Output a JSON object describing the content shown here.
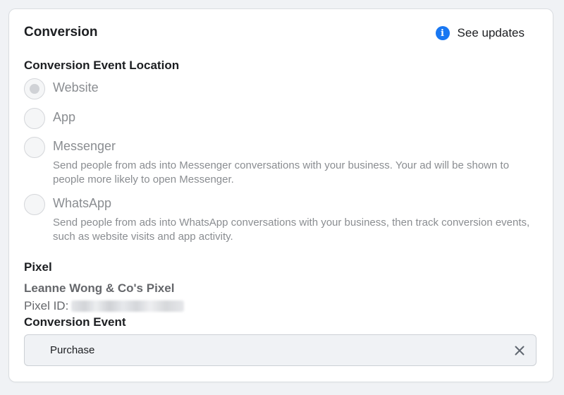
{
  "header": {
    "title": "Conversion",
    "updates_icon": "info-icon",
    "updates_label": "See updates"
  },
  "location": {
    "label": "Conversion Event Location",
    "options": [
      {
        "label": "Website",
        "description": "",
        "selected": true
      },
      {
        "label": "App",
        "description": "",
        "selected": false
      },
      {
        "label": "Messenger",
        "description": "Send people from ads into Messenger conversations with your business. Your ad will be shown to people more likely to open Messenger.",
        "selected": false
      },
      {
        "label": "WhatsApp",
        "description": "Send people from ads into WhatsApp conversations with your business, then track conversion events, such as website visits and app activity.",
        "selected": false
      }
    ]
  },
  "pixel": {
    "label": "Pixel",
    "name": "Leanne Wong & Co's Pixel",
    "id_label": "Pixel ID:"
  },
  "conversion_event": {
    "label": "Conversion Event",
    "value": "Purchase",
    "clear_icon": "close-icon"
  },
  "colors": {
    "accent": "#1877f2",
    "disabled_text": "#8a8d91",
    "secondary_text": "#65676b"
  }
}
